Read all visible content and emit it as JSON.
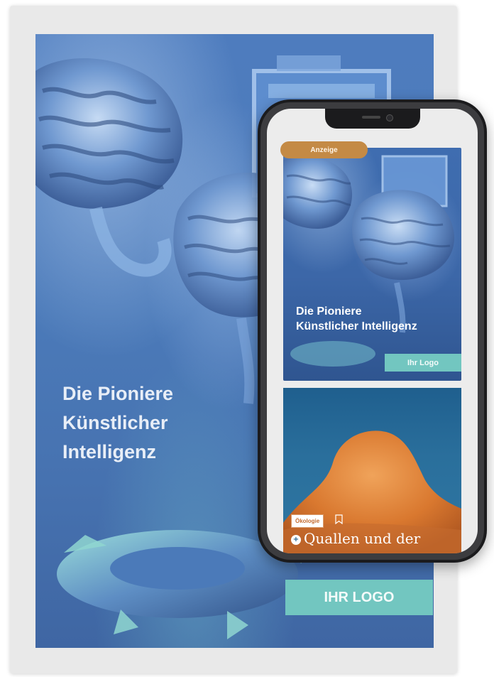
{
  "poster": {
    "title": "Die Pioniere\nKünstlicher\nIntelligenz",
    "logo_label": "IHR LOGO",
    "accent": "#72c6c0",
    "background": "#4b7ab9"
  },
  "phone": {
    "ad": {
      "badge": "Anzeige",
      "title": "Die Pioniere\nKünstlicher Intelligenz",
      "logo_label": "Ihr Logo",
      "badge_color": "#c48a45"
    },
    "article": {
      "tag": "Ökologie",
      "title": "Quallen und der",
      "bookmark_icon": "bookmark-icon",
      "plus_icon": "plus-badge-icon"
    }
  }
}
